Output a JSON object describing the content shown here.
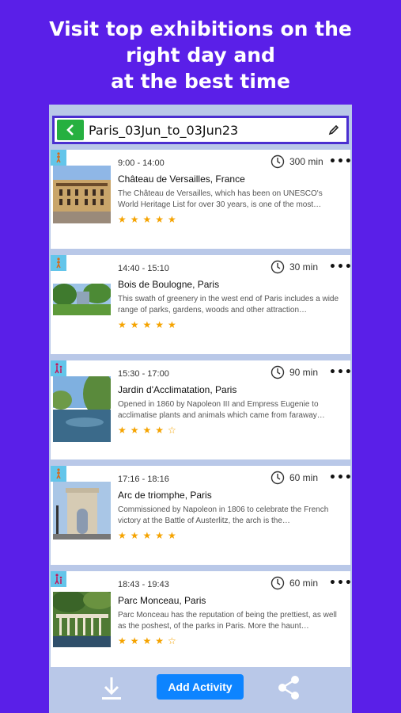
{
  "promo": {
    "line1": "Visit top exhibitions on the",
    "line2": "right day and",
    "line3": "at the best time"
  },
  "header": {
    "trip_name": "Paris_03Jun_to_03Jun23"
  },
  "activities": [
    {
      "time": "9:00 - 14:00",
      "duration": "300 min",
      "title": "Château de Versailles, France",
      "description": "The Château de Versailles, which has been on UNESCO's World Heritage List for over 30 years, is one of the most…",
      "stars": "★★★★★",
      "type_icon": "walk-icon"
    },
    {
      "time": "14:40 - 15:10",
      "duration": "30 min",
      "title": "Bois de Boulogne, Paris",
      "description": "This swath of greenery in the west end of Paris includes a wide range of parks, gardens, woods and other attraction…",
      "stars": "★★★★★",
      "type_icon": "walk-icon"
    },
    {
      "time": "15:30 - 17:00",
      "duration": "90 min",
      "title": "Jardin d'Acclimatation, Paris",
      "description": "Opened in 1860 by Napoleon III and Empress Eugenie to acclimatise plants and animals which came from faraway…",
      "stars": "★★★★☆",
      "type_icon": "family-icon"
    },
    {
      "time": "17:16 - 18:16",
      "duration": "60 min",
      "title": "Arc de triomphe, Paris",
      "description": "Commissioned by Napoleon in 1806 to celebrate the French victory at the Battle of Austerlitz, the arch is the…",
      "stars": "★★★★★",
      "type_icon": "walk-icon"
    },
    {
      "time": "18:43 - 19:43",
      "duration": "60 min",
      "title": "Parc Monceau, Paris",
      "description": "Parc Monceau has the reputation of being the prettiest, as well as the poshest, of the parks in Paris. More the haunt…",
      "stars": "★★★★☆",
      "type_icon": "family-icon"
    }
  ],
  "footer": {
    "add_label": "Add Activity"
  },
  "colors": {
    "background": "#5a1fe8",
    "accent_green": "#26b040",
    "button_blue": "#0d84ff",
    "star": "#f5a300",
    "badge": "#63c5ea"
  }
}
